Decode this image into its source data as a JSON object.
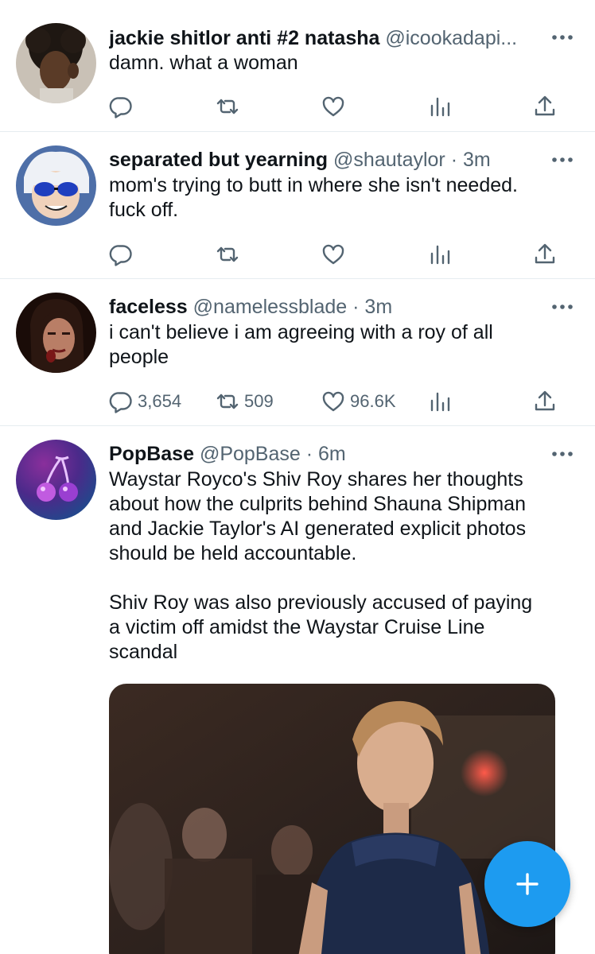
{
  "tweets": [
    {
      "name": "jackie shitlor anti #2 natasha",
      "handle": "@icookadapi...",
      "time": "",
      "text": [
        "damn. what a woman"
      ],
      "stats": {
        "reply": "",
        "retweet": "",
        "like": ""
      }
    },
    {
      "name": "separated but yearning",
      "handle": "@shautaylor",
      "time": "· 3m",
      "text": [
        "mom's trying to butt in where she isn't needed.",
        "fuck off."
      ],
      "stats": {
        "reply": "",
        "retweet": "",
        "like": ""
      }
    },
    {
      "name": "faceless",
      "handle": "@namelessblade",
      "time": "· 3m",
      "text": [
        "i can't believe i am agreeing with a roy of all",
        "people"
      ],
      "stats": {
        "reply": "3,654",
        "retweet": "509",
        "like": "96.6K"
      }
    },
    {
      "name": "PopBase",
      "handle": "@PopBase",
      "time": "· 6m",
      "text": [
        "Waystar Royco's Shiv Roy shares her thoughts",
        "about how the culprits behind Shauna Shipman",
        "and Jackie Taylor's AI generated explicit photos",
        "should be held accountable.",
        "",
        "Shiv Roy was also previously accused of paying",
        "a victim off amidst the Waystar Cruise Line",
        "scandal"
      ],
      "stats": {
        "reply": "",
        "retweet": "",
        "like": ""
      }
    }
  ],
  "icons": {
    "reply": "speech-bubble",
    "retweet": "retweet-arrows",
    "like": "heart",
    "views": "bar-chart",
    "share": "upload-arrow",
    "more": "three-dots",
    "compose": "plus"
  },
  "colors": {
    "text": "#0f1419",
    "muted": "#536471",
    "divider": "#e6ecf0",
    "accent": "#1d9bf0"
  }
}
